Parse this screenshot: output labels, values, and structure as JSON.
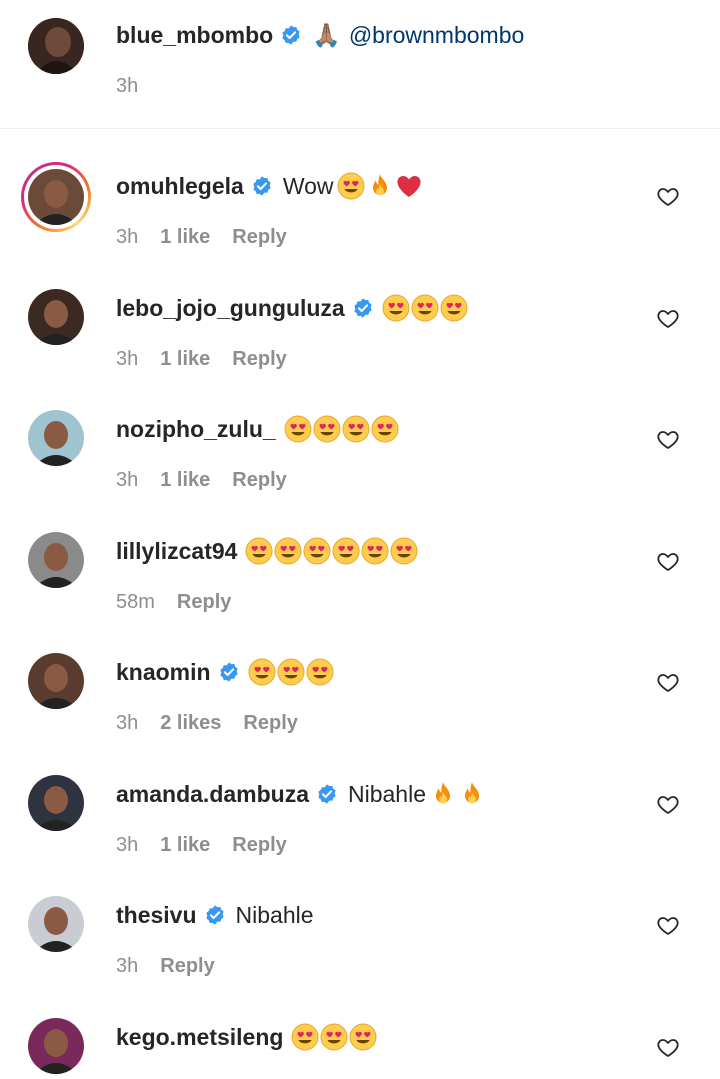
{
  "caption": {
    "username": "blue_mbombo",
    "emoji": "🙏🏽",
    "mention": "@brownmbombo",
    "time": "3h"
  },
  "colors": {
    "verified": "#3897f0",
    "secondary_text": "#8e8e8e",
    "mention": "#00376b"
  },
  "comments": [
    {
      "username": "omuhlegela",
      "verified": true,
      "text": "Wow",
      "emojis": [
        "heart-eyes",
        "fire",
        "red-heart"
      ],
      "time": "3h",
      "likes": "1 like",
      "reply": "Reply",
      "story_ring": true,
      "avatar_color": "#6b4a3a"
    },
    {
      "username": "lebo_jojo_gunguluza",
      "verified": true,
      "text": "",
      "emojis": [
        "heart-eyes",
        "heart-eyes",
        "heart-eyes"
      ],
      "time": "3h",
      "likes": "1 like",
      "reply": "Reply",
      "story_ring": false,
      "avatar_color": "#3b2a22"
    },
    {
      "username": "nozipho_zulu_",
      "verified": false,
      "text": "",
      "emojis": [
        "heart-eyes",
        "heart-eyes",
        "heart-eyes",
        "heart-eyes"
      ],
      "time": "3h",
      "likes": "1 like",
      "reply": "Reply",
      "story_ring": false,
      "avatar_color": "#9fc3cf"
    },
    {
      "username": "lillylizcat94",
      "verified": false,
      "text": "",
      "emojis": [
        "heart-eyes",
        "heart-eyes",
        "heart-eyes",
        "heart-eyes",
        "heart-eyes",
        "heart-eyes"
      ],
      "time": "58m",
      "likes": "",
      "reply": "Reply",
      "story_ring": false,
      "avatar_color": "#8a8a8a"
    },
    {
      "username": "knaomin",
      "verified": true,
      "text": "",
      "emojis": [
        "heart-eyes",
        "heart-eyes",
        "heart-eyes"
      ],
      "time": "3h",
      "likes": "2 likes",
      "reply": "Reply",
      "story_ring": false,
      "avatar_color": "#5a3c2e"
    },
    {
      "username": "amanda.dambuza",
      "verified": true,
      "text": "Nibahle",
      "emojis": [
        "fire",
        "fire"
      ],
      "time": "3h",
      "likes": "1 like",
      "reply": "Reply",
      "story_ring": false,
      "avatar_color": "#2f3340"
    },
    {
      "username": "thesivu",
      "verified": true,
      "text": "Nibahle",
      "emojis": [],
      "time": "3h",
      "likes": "",
      "reply": "Reply",
      "story_ring": false,
      "avatar_color": "#c9ccd2"
    },
    {
      "username": "kego.metsileng",
      "verified": false,
      "text": "",
      "emojis": [
        "heart-eyes",
        "heart-eyes",
        "heart-eyes"
      ],
      "time": "",
      "likes": "",
      "reply": "",
      "story_ring": false,
      "avatar_color": "#7a2a5a"
    }
  ]
}
